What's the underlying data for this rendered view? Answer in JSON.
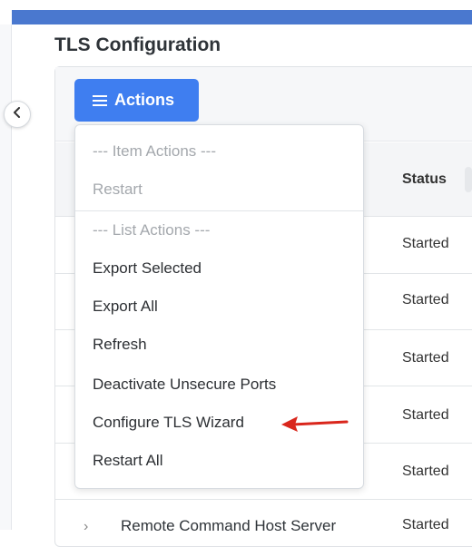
{
  "page": {
    "title": "TLS Configuration"
  },
  "toolbar": {
    "actions_label": "Actions"
  },
  "table": {
    "columns": {
      "status": "Status"
    },
    "rows": [
      {
        "status": "Started"
      },
      {
        "status": "Started"
      },
      {
        "status": "Started"
      },
      {
        "status": "Started"
      },
      {
        "status": "Started"
      }
    ],
    "last_row": {
      "name": "Remote Command Host Server",
      "status": "Started"
    }
  },
  "actions_menu": {
    "item_actions_header": "--- Item Actions ---",
    "restart": "Restart",
    "list_actions_header": "--- List Actions ---",
    "export_selected": "Export Selected",
    "export_all": "Export All",
    "refresh": "Refresh",
    "deactivate_unsecure_ports": "Deactivate Unsecure Ports",
    "configure_tls_wizard": "Configure TLS Wizard",
    "restart_all": "Restart All"
  },
  "colors": {
    "accent": "#3f7ef0",
    "topbar": "#4a78cf",
    "annotation": "#d9261c"
  }
}
